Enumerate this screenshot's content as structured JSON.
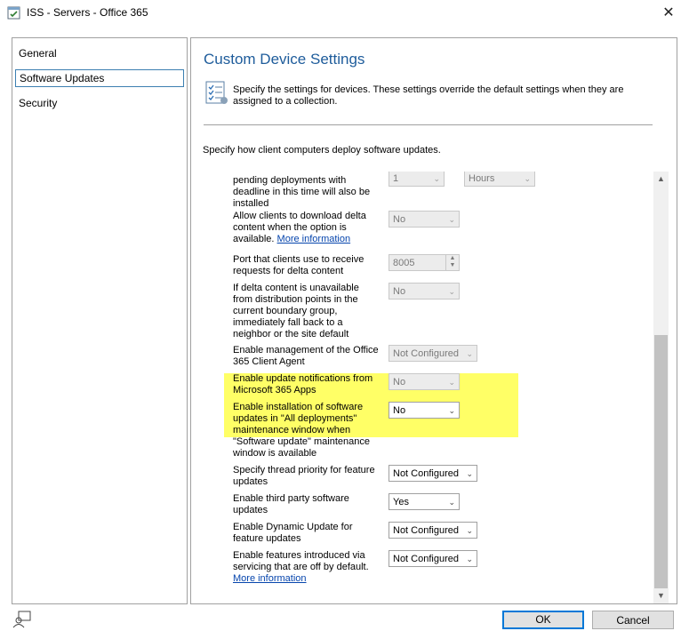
{
  "window": {
    "title": "ISS - Servers - Office 365"
  },
  "nav": {
    "items": [
      {
        "label": "General",
        "selected": false
      },
      {
        "label": "Software Updates",
        "selected": true
      },
      {
        "label": "Security",
        "selected": false
      }
    ]
  },
  "content": {
    "heading": "Custom Device Settings",
    "description": "Specify the settings for devices. These settings override the default settings when they are assigned to a collection.",
    "intro": "Specify how client computers deploy software updates."
  },
  "settings": {
    "r0": {
      "label": "Period of time for which all pending deployments with deadline in this time will also be installed",
      "value": "1",
      "unit": "Hours"
    },
    "r1": {
      "label": "Allow clients to download delta content when the option is available.",
      "link": "More information",
      "value": "No"
    },
    "r2": {
      "label": "Port that clients use to receive requests for delta content",
      "value": "8005"
    },
    "r3": {
      "label": "If delta content is unavailable from distribution points in the current boundary group, immediately fall back to a neighbor or the site default",
      "value": "No"
    },
    "r4": {
      "label": "Enable management of the Office 365 Client Agent",
      "value": "Not Configured"
    },
    "r5": {
      "label": "Enable update notifications from Microsoft 365 Apps",
      "value": "No"
    },
    "r6": {
      "label": "Enable installation of software updates in \"All deployments\" maintenance window when \"Software update\" maintenance window is available",
      "value": "No"
    },
    "r7": {
      "label": "Specify thread priority for feature updates",
      "value": "Not Configured"
    },
    "r8": {
      "label": "Enable third party software updates",
      "value": "Yes"
    },
    "r9": {
      "label": "Enable Dynamic Update for feature updates",
      "value": "Not Configured"
    },
    "r10": {
      "label": "Enable features introduced via servicing that are off by default.",
      "link": "More information",
      "value": "Not Configured"
    }
  },
  "highlight_color": "#ffff66",
  "accent_color": "#1e5c9b",
  "buttons": {
    "ok": "OK",
    "cancel": "Cancel"
  },
  "icons": {
    "title": "settings-window-icon",
    "description": "settings-list-icon",
    "status": "user-feedback-icon",
    "close": "close-icon"
  }
}
